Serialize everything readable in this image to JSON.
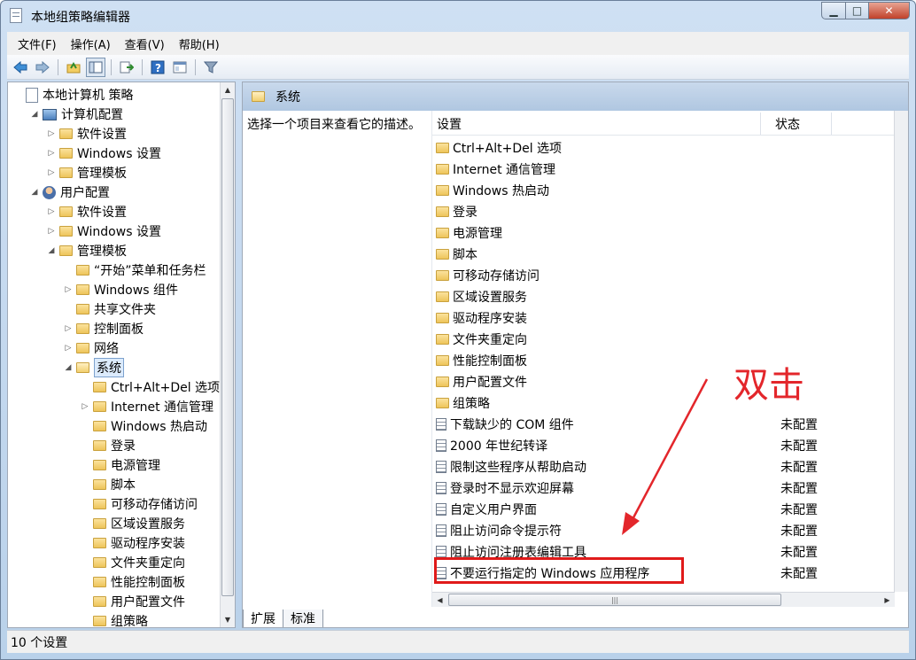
{
  "window": {
    "title": "本地组策略编辑器"
  },
  "menu": [
    "文件(F)",
    "操作(A)",
    "查看(V)",
    "帮助(H)"
  ],
  "toolbar": [
    "back-icon",
    "forward-icon",
    "up-folder-icon",
    "show-tree-icon",
    "export-icon",
    "help-icon",
    "properties-icon",
    "filter-icon"
  ],
  "tree": [
    {
      "label": "本地计算机 策略",
      "indent": 0,
      "icon": "doc",
      "exp": ""
    },
    {
      "label": "计算机配置",
      "indent": 1,
      "icon": "pc",
      "exp": "◢"
    },
    {
      "label": "软件设置",
      "indent": 2,
      "icon": "folder",
      "exp": "▷"
    },
    {
      "label": "Windows 设置",
      "indent": 2,
      "icon": "folder",
      "exp": "▷"
    },
    {
      "label": "管理模板",
      "indent": 2,
      "icon": "folder",
      "exp": "▷"
    },
    {
      "label": "用户配置",
      "indent": 1,
      "icon": "user",
      "exp": "◢"
    },
    {
      "label": "软件设置",
      "indent": 2,
      "icon": "folder",
      "exp": "▷"
    },
    {
      "label": "Windows 设置",
      "indent": 2,
      "icon": "folder",
      "exp": "▷"
    },
    {
      "label": "管理模板",
      "indent": 2,
      "icon": "folder",
      "exp": "◢"
    },
    {
      "label": "“开始”菜单和任务栏",
      "indent": 3,
      "icon": "folder",
      "exp": ""
    },
    {
      "label": "Windows 组件",
      "indent": 3,
      "icon": "folder",
      "exp": "▷"
    },
    {
      "label": "共享文件夹",
      "indent": 3,
      "icon": "folder",
      "exp": ""
    },
    {
      "label": "控制面板",
      "indent": 3,
      "icon": "folder",
      "exp": "▷"
    },
    {
      "label": "网络",
      "indent": 3,
      "icon": "folder",
      "exp": "▷"
    },
    {
      "label": "系统",
      "indent": 3,
      "icon": "folder-open",
      "exp": "◢",
      "selected": true
    },
    {
      "label": "Ctrl+Alt+Del 选项",
      "indent": 4,
      "icon": "folder",
      "exp": ""
    },
    {
      "label": "Internet 通信管理",
      "indent": 4,
      "icon": "folder",
      "exp": "▷"
    },
    {
      "label": "Windows 热启动",
      "indent": 4,
      "icon": "folder",
      "exp": ""
    },
    {
      "label": "登录",
      "indent": 4,
      "icon": "folder",
      "exp": ""
    },
    {
      "label": "电源管理",
      "indent": 4,
      "icon": "folder",
      "exp": ""
    },
    {
      "label": "脚本",
      "indent": 4,
      "icon": "folder",
      "exp": ""
    },
    {
      "label": "可移动存储访问",
      "indent": 4,
      "icon": "folder",
      "exp": ""
    },
    {
      "label": "区域设置服务",
      "indent": 4,
      "icon": "folder",
      "exp": ""
    },
    {
      "label": "驱动程序安装",
      "indent": 4,
      "icon": "folder",
      "exp": ""
    },
    {
      "label": "文件夹重定向",
      "indent": 4,
      "icon": "folder",
      "exp": ""
    },
    {
      "label": "性能控制面板",
      "indent": 4,
      "icon": "folder",
      "exp": ""
    },
    {
      "label": "用户配置文件",
      "indent": 4,
      "icon": "folder",
      "exp": ""
    },
    {
      "label": "组策略",
      "indent": 4,
      "icon": "folder",
      "exp": ""
    }
  ],
  "right": {
    "header": "系统",
    "description": "选择一个项目来查看它的描述。",
    "columns": {
      "setting": "设置",
      "state": "状态"
    },
    "rows": [
      {
        "name": "Ctrl+Alt+Del 选项",
        "type": "folder",
        "state": ""
      },
      {
        "name": "Internet 通信管理",
        "type": "folder",
        "state": ""
      },
      {
        "name": "Windows 热启动",
        "type": "folder",
        "state": ""
      },
      {
        "name": "登录",
        "type": "folder",
        "state": ""
      },
      {
        "name": "电源管理",
        "type": "folder",
        "state": ""
      },
      {
        "name": "脚本",
        "type": "folder",
        "state": ""
      },
      {
        "name": "可移动存储访问",
        "type": "folder",
        "state": ""
      },
      {
        "name": "区域设置服务",
        "type": "folder",
        "state": ""
      },
      {
        "name": "驱动程序安装",
        "type": "folder",
        "state": ""
      },
      {
        "name": "文件夹重定向",
        "type": "folder",
        "state": ""
      },
      {
        "name": "性能控制面板",
        "type": "folder",
        "state": ""
      },
      {
        "name": "用户配置文件",
        "type": "folder",
        "state": ""
      },
      {
        "name": "组策略",
        "type": "folder",
        "state": ""
      },
      {
        "name": "下载缺少的 COM 组件",
        "type": "setting",
        "state": "未配置"
      },
      {
        "name": "2000 年世纪转译",
        "type": "setting",
        "state": "未配置"
      },
      {
        "name": "限制这些程序从帮助启动",
        "type": "setting",
        "state": "未配置"
      },
      {
        "name": "登录时不显示欢迎屏幕",
        "type": "setting",
        "state": "未配置"
      },
      {
        "name": "自定义用户界面",
        "type": "setting",
        "state": "未配置"
      },
      {
        "name": "阻止访问命令提示符",
        "type": "setting",
        "state": "未配置"
      },
      {
        "name": "阻止访问注册表编辑工具",
        "type": "setting",
        "state": "未配置"
      },
      {
        "name": "不要运行指定的 Windows 应用程序",
        "type": "setting",
        "state": "未配置"
      }
    ],
    "tabs": [
      "扩展",
      "标准"
    ]
  },
  "status": "10 个设置",
  "annotation": {
    "text": "双击",
    "color": "#e3262b"
  }
}
